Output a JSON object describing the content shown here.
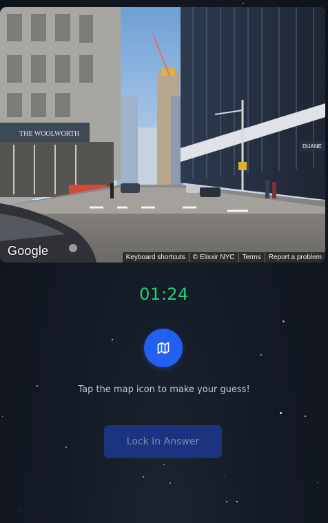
{
  "street_view": {
    "logo_text": "Google",
    "attribution": {
      "keyboard_shortcuts": "Keyboard shortcuts",
      "copyright": "© Elixxir NYC",
      "terms": "Terms",
      "report": "Report a problem"
    },
    "building_sign": "THE WOOLWORTH",
    "store_sign": "DUANE"
  },
  "game": {
    "timer": "01:24",
    "map_icon": "map-icon",
    "hint": "Tap the map icon to make your guess!",
    "lock_label": "Lock In Answer"
  },
  "colors": {
    "timer": "#1fd177",
    "map_button": "#2360f0",
    "lock_button": "#1c3480"
  }
}
